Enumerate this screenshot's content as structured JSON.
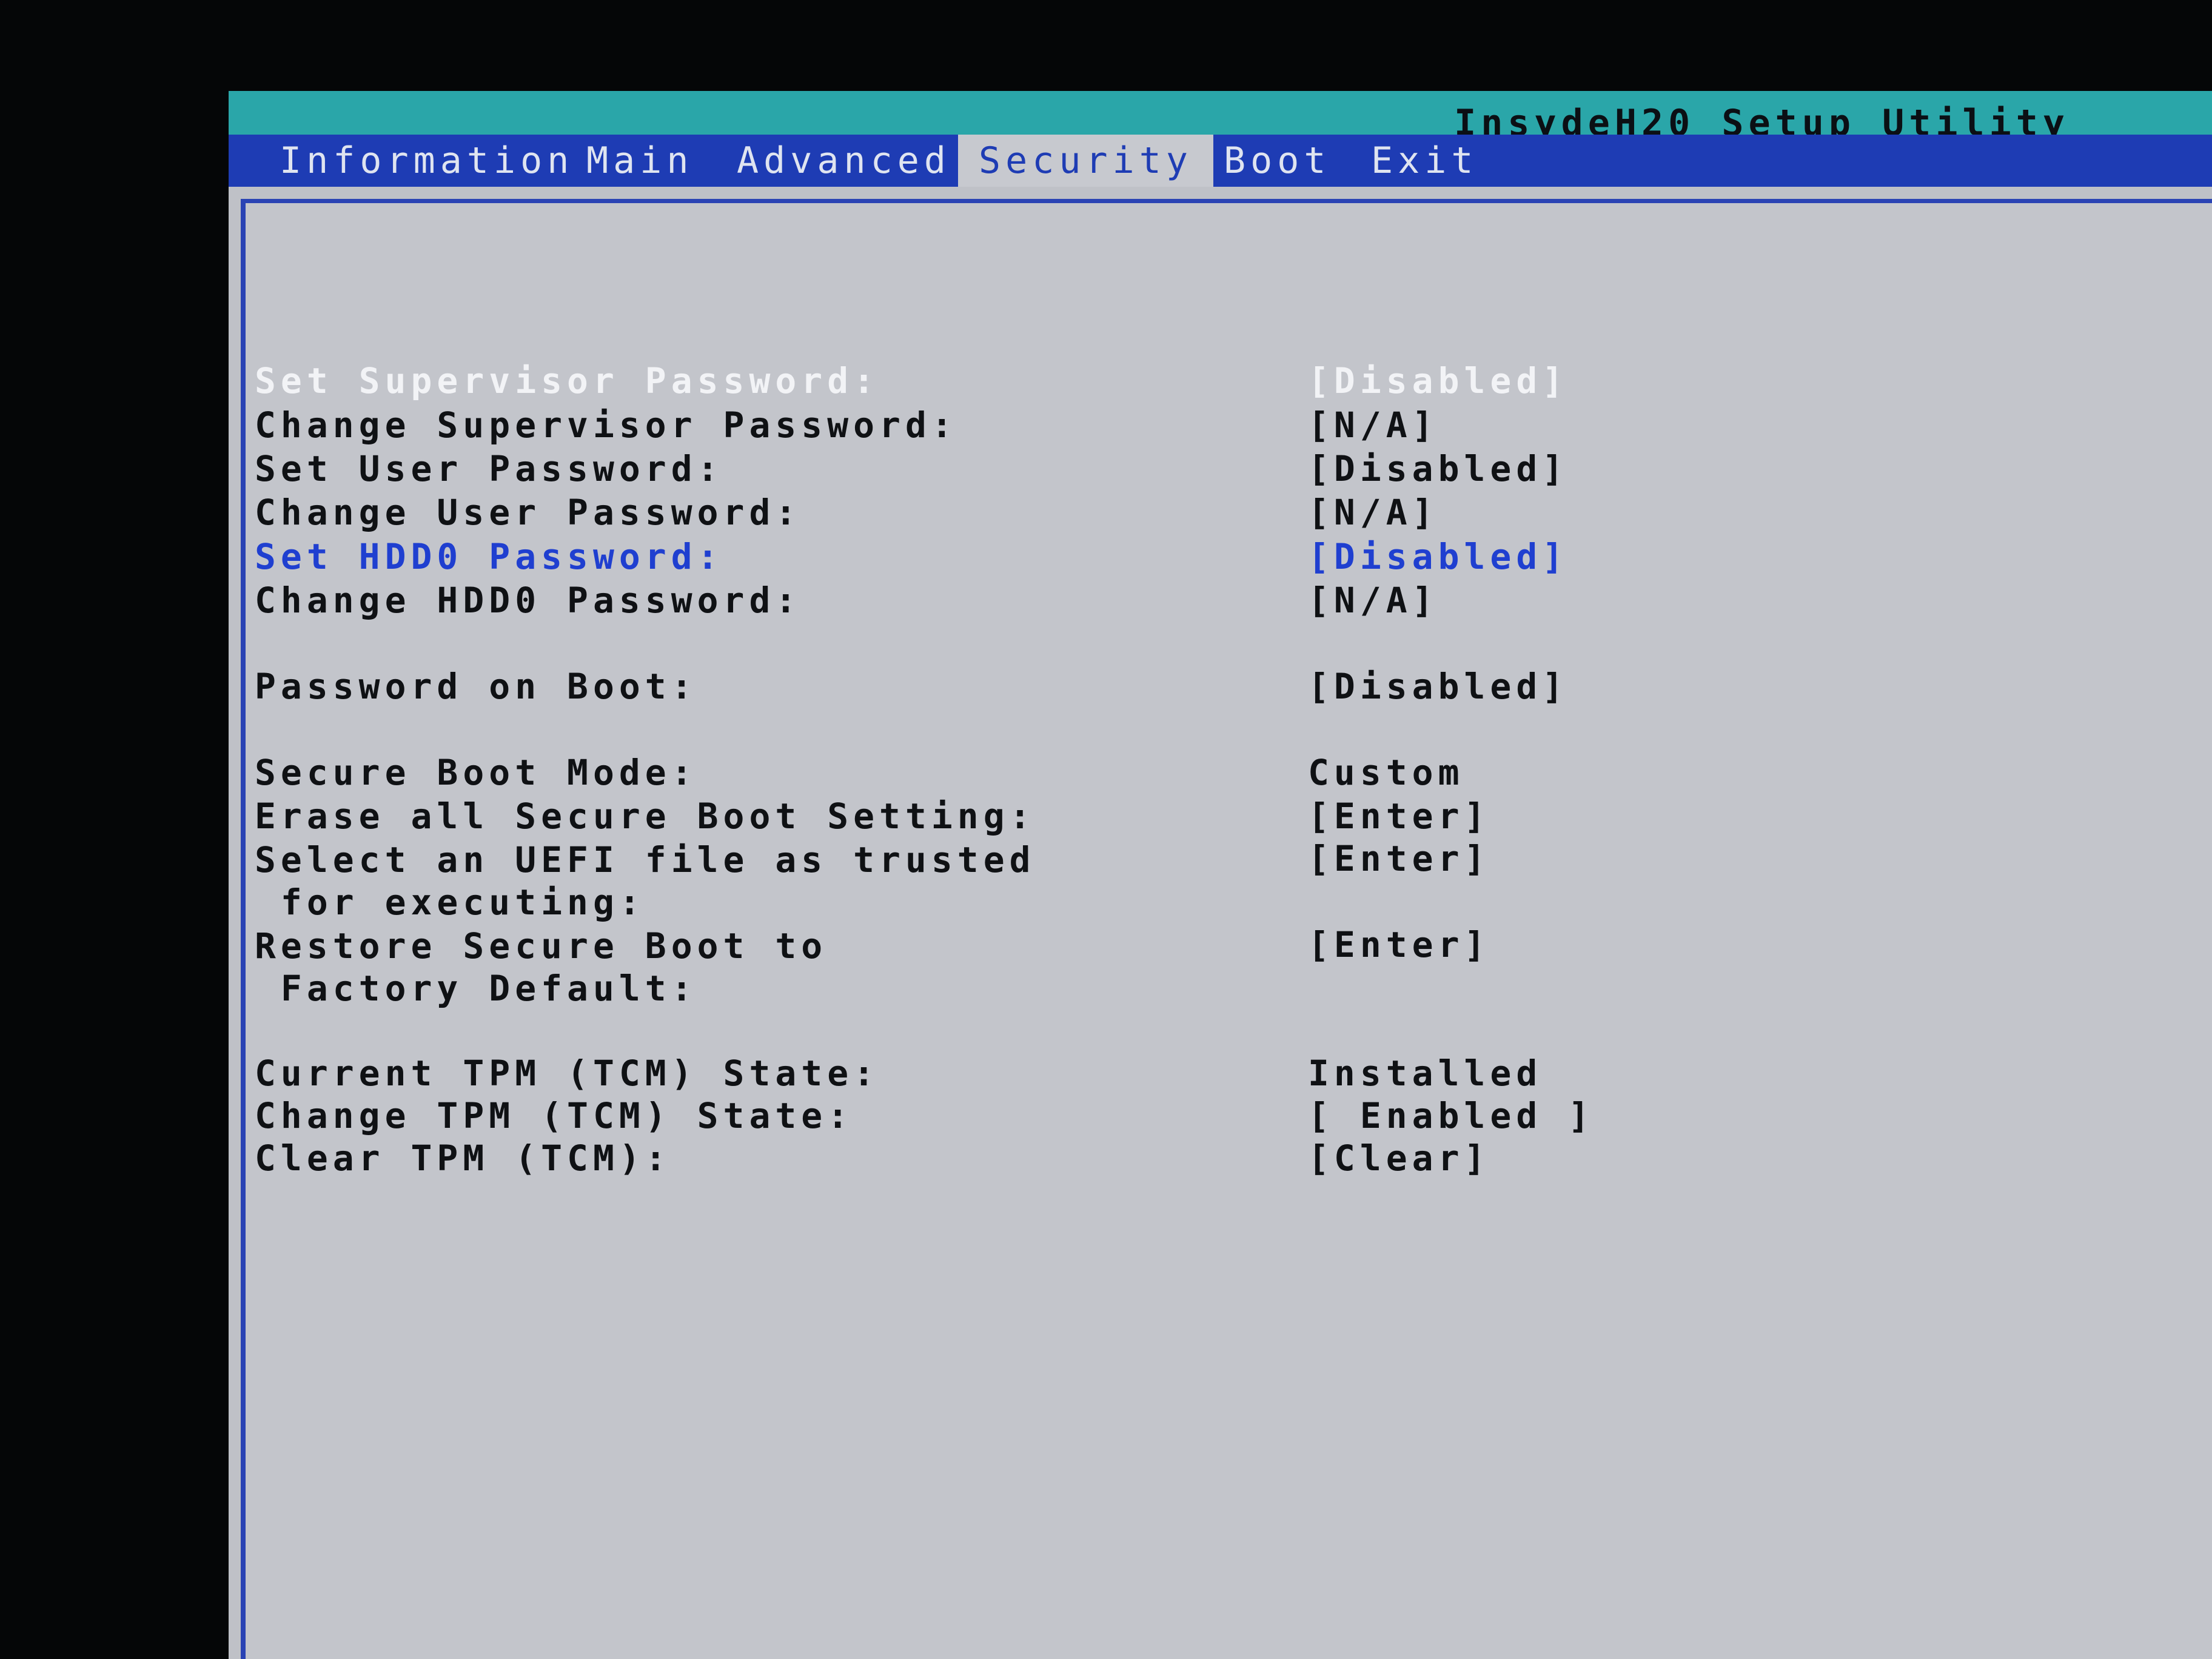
{
  "header": {
    "title": "InsydeH20 Setup Utility"
  },
  "menu": {
    "tabs": [
      {
        "label": "Information"
      },
      {
        "label": "Main"
      },
      {
        "label": "Advanced"
      },
      {
        "label": "Security"
      },
      {
        "label": "Boot"
      },
      {
        "label": "Exit"
      }
    ],
    "active_tab": "Security"
  },
  "security": {
    "items": [
      {
        "label": "Set Supervisor Password:",
        "value": "[Disabled]"
      },
      {
        "label": "Change Supervisor Password:",
        "value": "[N/A]"
      },
      {
        "label": "Set User Password:",
        "value": "[Disabled]"
      },
      {
        "label": "Change User Password:",
        "value": "[N/A]"
      },
      {
        "label": "Set HDD0 Password:",
        "value": "[Disabled]"
      },
      {
        "label": "Change HDD0 Password:",
        "value": "[N/A]"
      },
      {
        "label": "Password on Boot:",
        "value": "[Disabled]"
      },
      {
        "label": "Secure Boot Mode:",
        "value": "Custom"
      },
      {
        "label": "Erase all Secure Boot Setting:",
        "value": "[Enter]"
      },
      {
        "label": "Select an UEFI file as trusted\n for executing:",
        "value": "[Enter]"
      },
      {
        "label": "Restore Secure Boot to\n Factory Default:",
        "value": "[Enter]"
      },
      {
        "label": "Current TPM (TCM) State:",
        "value": "Installed"
      },
      {
        "label": "Change TPM (TCM) State:",
        "value": "[ Enabled ]"
      },
      {
        "label": "Clear TPM (TCM):",
        "value": "[Clear]"
      }
    ]
  },
  "colors": {
    "title_bar": "#2aa6a9",
    "menu_bar": "#1e3cb4",
    "background": "#c3c5cb",
    "selected_text": "#1f3fd0",
    "dim_text": "#f2f3f6"
  }
}
